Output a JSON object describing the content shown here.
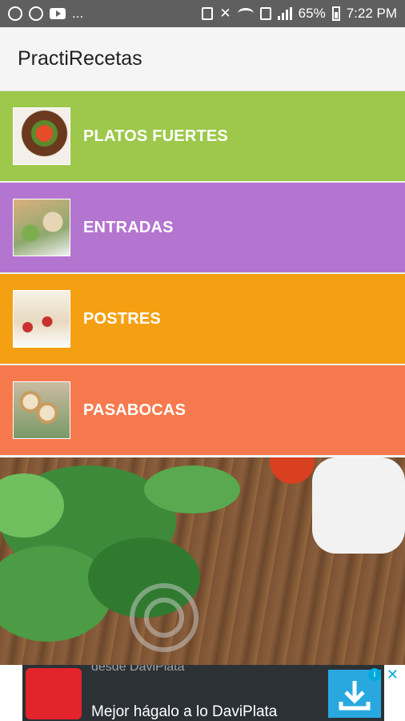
{
  "status_bar": {
    "more": "...",
    "battery": "65%",
    "time": "7:22 PM"
  },
  "app_bar": {
    "title": "PractiRecetas"
  },
  "categories": [
    {
      "label": "PLATOS FUERTES",
      "color": "#9dc84b",
      "icon": "steak-dish-image"
    },
    {
      "label": "ENTRADAS",
      "color": "#b475d0",
      "icon": "appetizer-platter-image"
    },
    {
      "label": "POSTRES",
      "color": "#f5a013",
      "icon": "dessert-cups-image"
    },
    {
      "label": "PASABOCAS",
      "color": "#f67a4d",
      "icon": "rolls-snack-image"
    }
  ],
  "ad": {
    "title": "desde DaviPlata",
    "text": "Mejor hágalo a lo DaviPlata",
    "info": "i",
    "close": "✕"
  }
}
